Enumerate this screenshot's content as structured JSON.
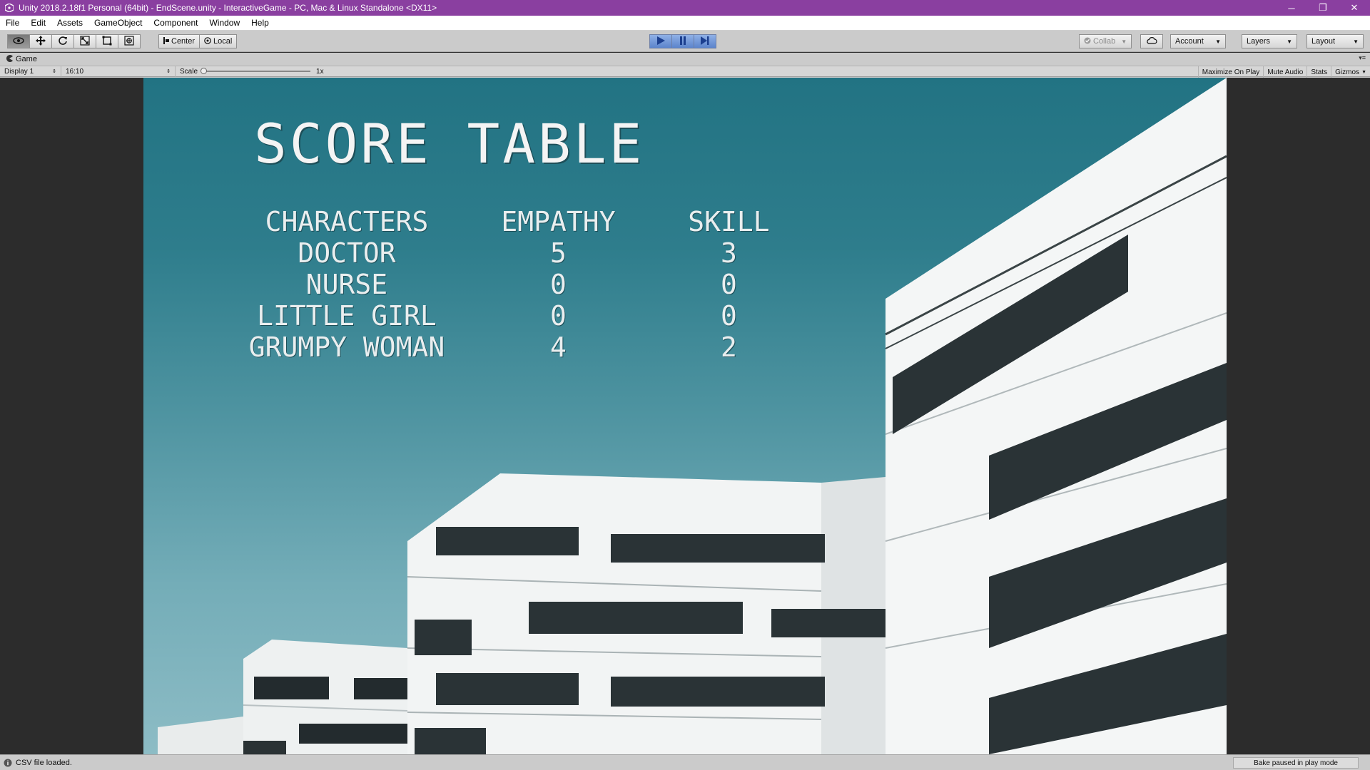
{
  "window": {
    "title": "Unity 2018.2.18f1 Personal (64bit) - EndScene.unity - InteractiveGame - PC, Mac & Linux Standalone <DX11>",
    "minimize": "─",
    "restore": "❐",
    "close": "✕"
  },
  "menu": [
    "File",
    "Edit",
    "Assets",
    "GameObject",
    "Component",
    "Window",
    "Help"
  ],
  "toolbar": {
    "pivot_label": "Center",
    "rotation_label": "Local",
    "collab_label": "Collab",
    "account_label": "Account",
    "layers_label": "Layers",
    "layout_label": "Layout"
  },
  "game_panel": {
    "tab_label": "Game",
    "display_label": "Display 1",
    "aspect_label": "16:10",
    "scale_label": "Scale",
    "scale_value": "1x",
    "maximize_label": "Maximize On Play",
    "mute_label": "Mute Audio",
    "stats_label": "Stats",
    "gizmos_label": "Gizmos"
  },
  "game": {
    "title": "SCORE TABLE",
    "headers": [
      "CHARACTERS",
      "EMPATHY",
      "SKILL"
    ],
    "rows": [
      {
        "name": "DOCTOR",
        "empathy": "5",
        "skill": "3"
      },
      {
        "name": "NURSE",
        "empathy": "0",
        "skill": "0"
      },
      {
        "name": "LITTLE GIRL",
        "empathy": "0",
        "skill": "0"
      },
      {
        "name": "GRUMPY WOMAN",
        "empathy": "4",
        "skill": "2"
      }
    ]
  },
  "status": {
    "message": "CSV file loaded.",
    "bake_label": "Bake paused in play mode"
  },
  "colors": {
    "titlebar": "#8a3fa0",
    "play_accent": "#5c84cc",
    "sky_top": "#227383",
    "sky_bottom": "#8dbcc5"
  }
}
